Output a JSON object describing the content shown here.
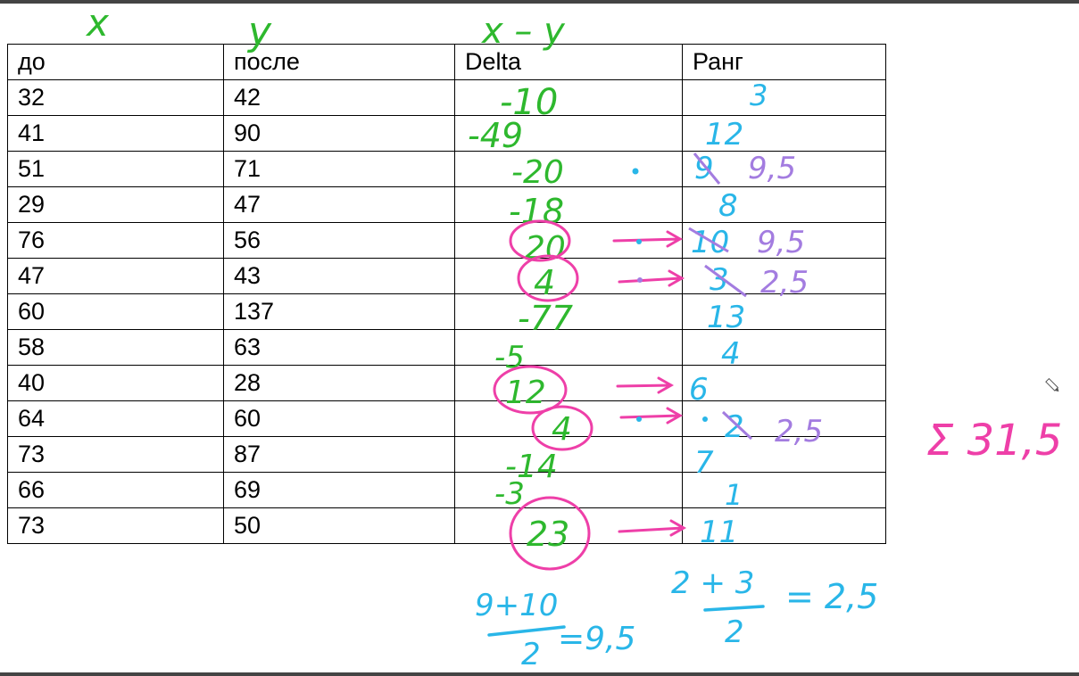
{
  "columns": [
    "до",
    "после",
    "Delta",
    "Ранг"
  ],
  "rows": [
    [
      "32",
      "42"
    ],
    [
      "41",
      "90"
    ],
    [
      "51",
      "71"
    ],
    [
      "29",
      "47"
    ],
    [
      "76",
      "56"
    ],
    [
      "47",
      "43"
    ],
    [
      "60",
      "137"
    ],
    [
      "58",
      "63"
    ],
    [
      "40",
      "28"
    ],
    [
      "64",
      "60"
    ],
    [
      "73",
      "87"
    ],
    [
      "66",
      "69"
    ],
    [
      "73",
      "50"
    ]
  ],
  "annotations": {
    "col_x": "x",
    "col_y": "y",
    "col_delta": "x – y",
    "deltas": [
      "-10",
      "-49",
      "-20",
      "-18",
      "20",
      "4",
      "-77",
      "-5",
      "12",
      "4",
      "-14",
      "-3",
      "23"
    ],
    "ranks": [
      "3",
      "12",
      "9",
      "8",
      "10",
      "3",
      "13",
      "4",
      "6",
      "2",
      "7",
      "1",
      "11"
    ],
    "corrected_ranks": {
      "r2": "9,5",
      "r4": "9,5",
      "r5": "2,5",
      "r9": "2,5"
    },
    "formula1": {
      "numerator": "9+10",
      "denominator": "2",
      "result": "=9,5"
    },
    "formula2": {
      "numerator": "2 + 3",
      "denominator": "2",
      "result": "= 2,5"
    },
    "sum": "Σ 31,5"
  },
  "colors": {
    "green": "#2eb82e",
    "blue": "#29b6e8",
    "purple": "#a37ce0",
    "pink": "#ee3fa8"
  }
}
